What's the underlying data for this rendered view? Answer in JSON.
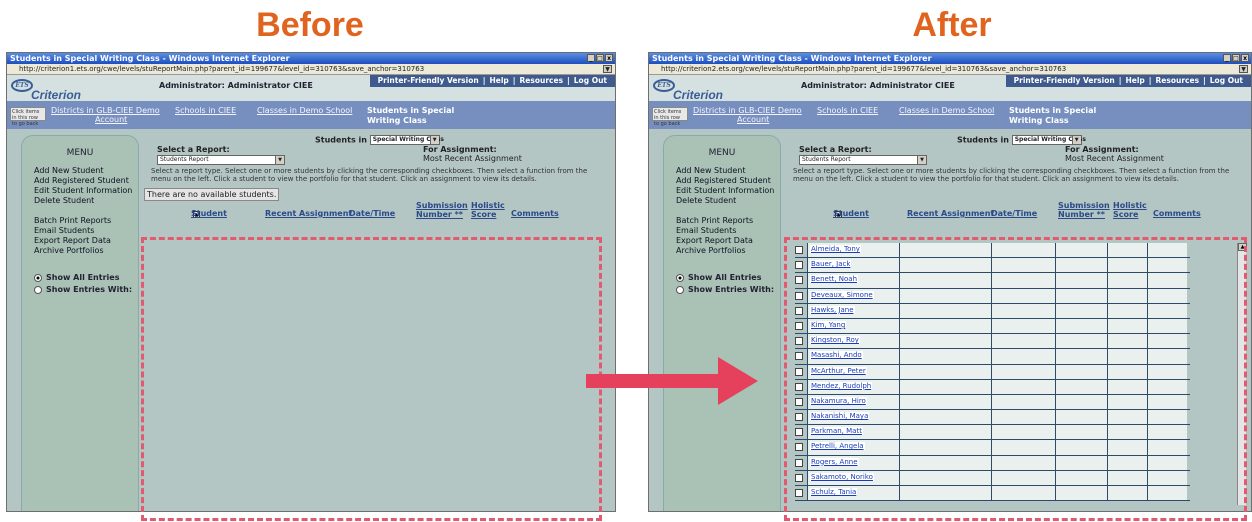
{
  "labels": {
    "before": "Before",
    "after": "After"
  },
  "before": {
    "title": "Students in Special Writing Class - Windows Internet Explorer",
    "url": "http://criterion1.ets.org/cwe/levels/stuReportMain.php?parent_id=199677&level_id=310763&save_anchor=310763",
    "empty_message": "There are no available students."
  },
  "after": {
    "title": "Students in Special Writing Class - Windows Internet Explorer",
    "url": "http://criterion2.ets.org/cwe/levels/stuReportMain.php?parent_id=199677&level_id=310763&save_anchor=310763",
    "students": [
      "Almeida, Tony",
      "Bauer, Jack",
      "Benett, Noah",
      "Deveaux, Simone",
      "Hawks, Jane",
      "Kim, Yang",
      "Kingston, Roy",
      "Masashi, Ando",
      "McArthur, Peter",
      "Mendez, Rudolph",
      "Nakamura, Hiro",
      "Nakanishi, Maya",
      "Parkman, Matt",
      "Petrelli, Angela",
      "Rogers, Anne",
      "Sakamoto, Noriko",
      "Schulz, Tania"
    ]
  },
  "common": {
    "ets": "ETS",
    "criterion": "Criterion",
    "admin": "Administrator: Administrator CIEE",
    "topnav": [
      "Printer-Friendly Version",
      "Help",
      "Resources",
      "Log Out"
    ],
    "click_hint": "Click items in this row to go back",
    "crumb1": "Districts in GLB-CIEE Demo",
    "crumb1b": "Account",
    "crumb2": "Schools in CIEE",
    "crumb3": "Classes in Demo School",
    "crumb_current": "Students in Special Writing Class",
    "menu_title": "MENU",
    "menu_items": [
      "Add New Student",
      "Add Registered Student",
      "Edit Student Information",
      "Delete Student",
      "Batch Print Reports",
      "Email Students",
      "Export Report Data",
      "Archive Portfolios"
    ],
    "show_all": "Show All Entries",
    "show_with": "Show Entries With:",
    "students_in_label": "Students in",
    "class_select": "Special Writing Class",
    "select_report_label": "Select a Report:",
    "report_select": "Students Report",
    "for_assignment": "For Assignment:",
    "most_recent": "Most Recent Assignment",
    "instructions": "Select a report type. Select one or more students by clicking the corresponding checkboxes. Then select a function from the menu on the left. Click a student to view the portfolio for that student. Click an assignment to view its details.",
    "col_student": "Student",
    "col_recent": "Recent Assignment",
    "col_date": "Date/Time",
    "col_sub": "Submission",
    "col_number": "Number **",
    "col_hol": "Holistic",
    "col_score": "Score",
    "col_comments": "Comments"
  },
  "colors": {
    "heading": "#e06420",
    "highlight": "#e25a6e",
    "arrow": "#e5415c"
  }
}
